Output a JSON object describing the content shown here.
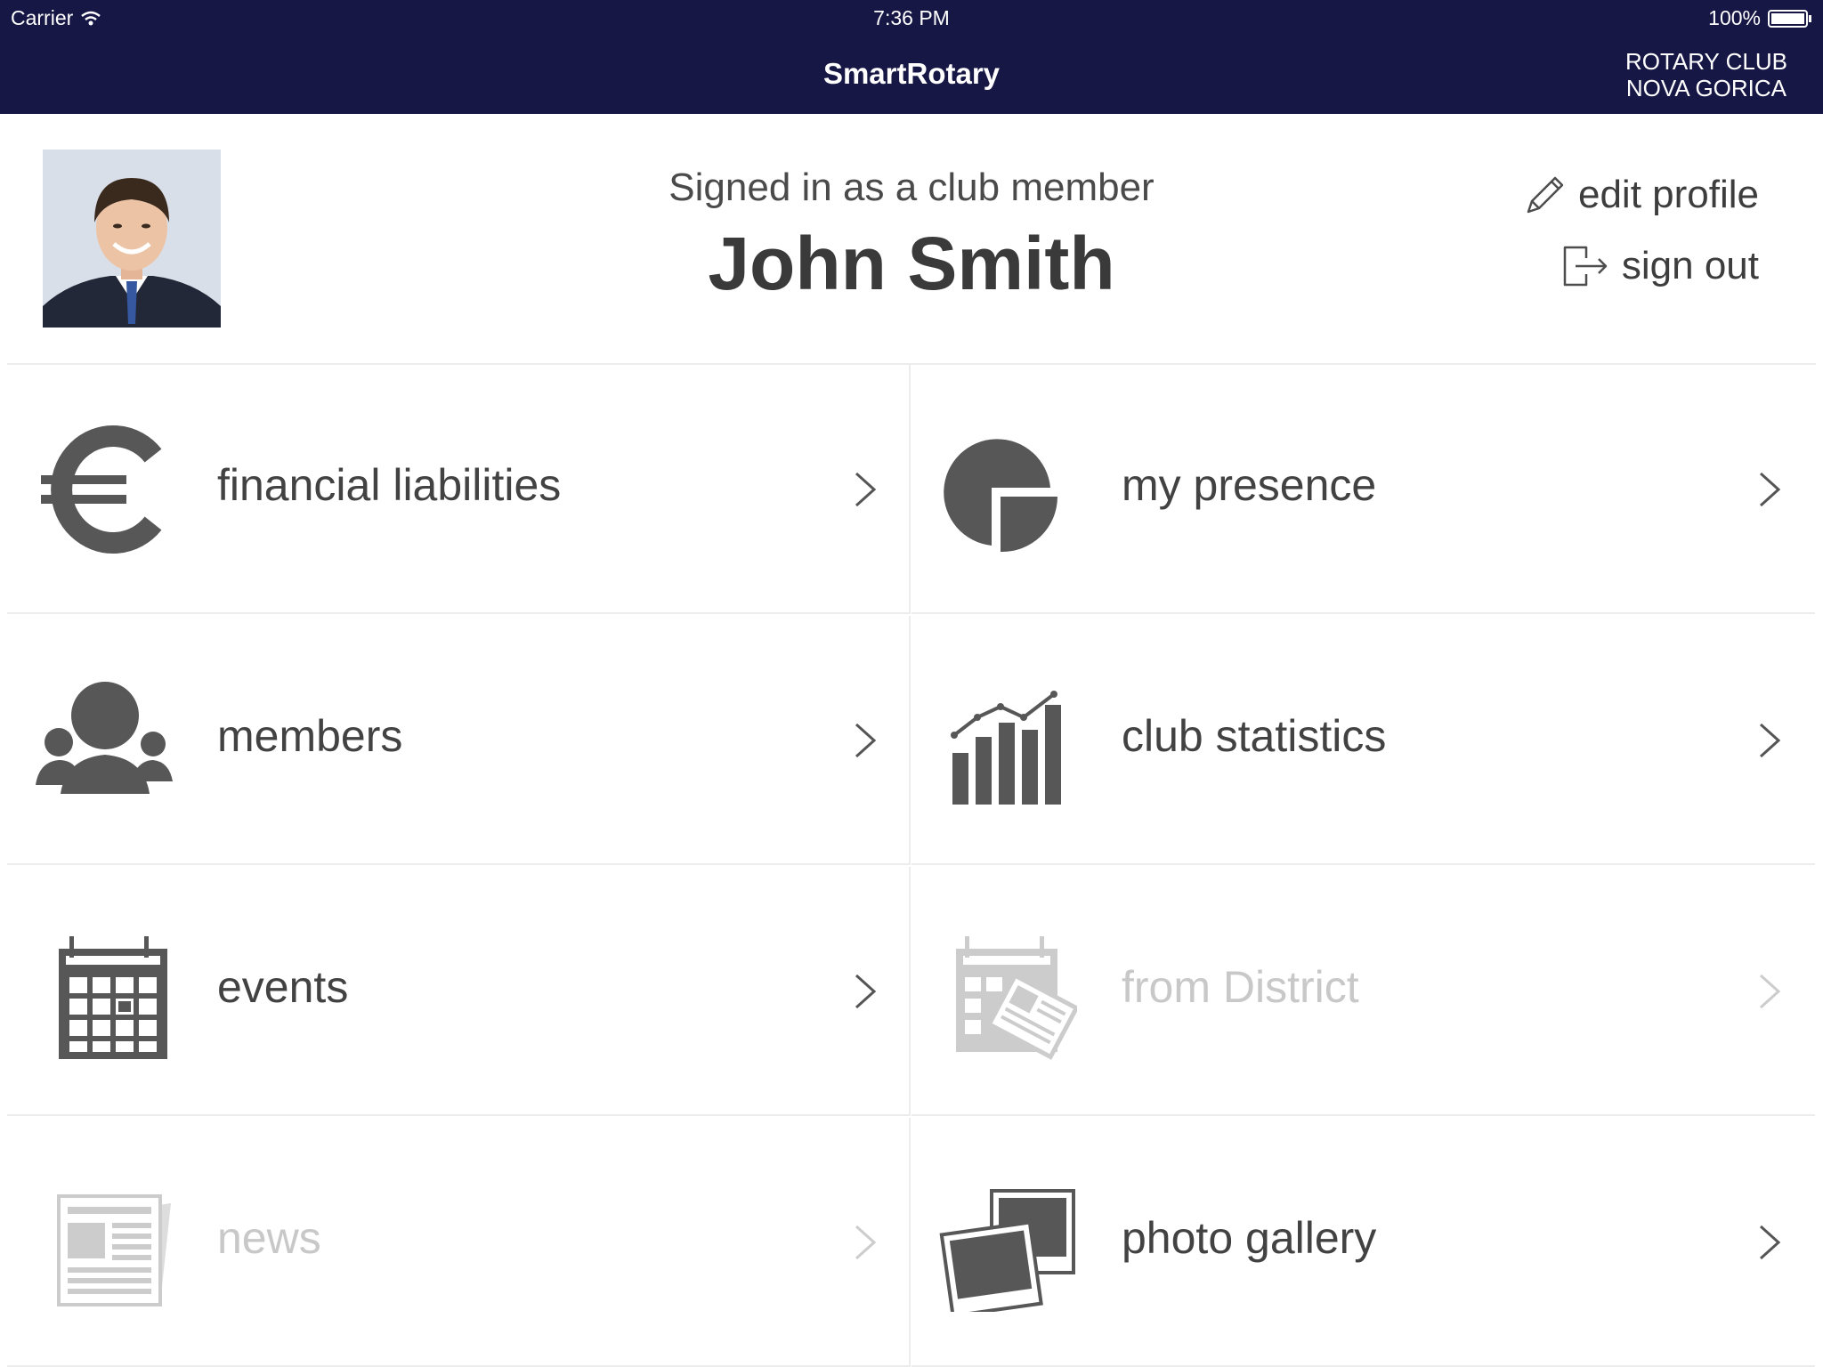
{
  "status_bar": {
    "carrier": "Carrier",
    "time": "7:36 PM",
    "battery": "100%"
  },
  "nav": {
    "title": "SmartRotary",
    "club_line1": "ROTARY CLUB",
    "club_line2": "NOVA GORICA"
  },
  "profile": {
    "signed_in_text": "Signed in as a club member",
    "name": "John Smith",
    "edit_label": "edit profile",
    "signout_label": "sign out"
  },
  "menu": [
    {
      "label": "financial liabilities",
      "icon": "euro-icon",
      "enabled": true
    },
    {
      "label": "my presence",
      "icon": "pie-chart-icon",
      "enabled": true
    },
    {
      "label": "members",
      "icon": "members-icon",
      "enabled": true
    },
    {
      "label": "club statistics",
      "icon": "bar-chart-icon",
      "enabled": true
    },
    {
      "label": "events",
      "icon": "calendar-icon",
      "enabled": true
    },
    {
      "label": "from District",
      "icon": "district-icon",
      "enabled": false
    },
    {
      "label": "news",
      "icon": "newspaper-icon",
      "enabled": false
    },
    {
      "label": "photo gallery",
      "icon": "photo-gallery-icon",
      "enabled": true
    }
  ],
  "colors": {
    "nav_background": "#161745",
    "text": "#424242",
    "disabled_text": "#c8c8c8",
    "icon": "#575757",
    "disabled_icon": "#cccccc"
  }
}
